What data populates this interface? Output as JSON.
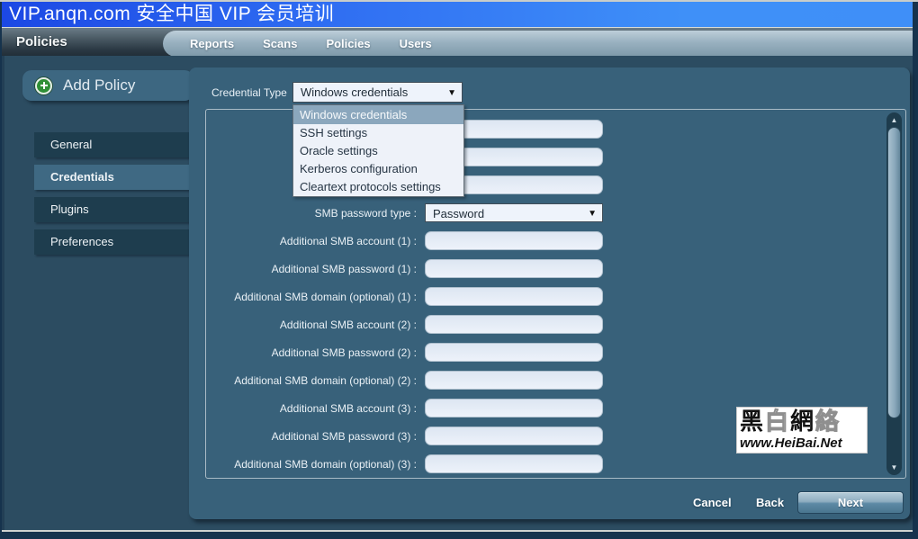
{
  "title_bar": {
    "text": "VIP.anqn.com 安全中国 VIP 会员培训"
  },
  "nav": {
    "section_title": "Policies",
    "tabs": [
      {
        "label": "Reports"
      },
      {
        "label": "Scans"
      },
      {
        "label": "Policies"
      },
      {
        "label": "Users"
      }
    ]
  },
  "sidebar": {
    "header": {
      "label": "Add Policy",
      "icon": "plus-icon"
    },
    "items": [
      {
        "label": "General",
        "selected": false
      },
      {
        "label": "Credentials",
        "selected": true
      },
      {
        "label": "Plugins",
        "selected": false
      },
      {
        "label": "Preferences",
        "selected": false
      }
    ]
  },
  "main": {
    "credential_type": {
      "label": "Credential Type",
      "value": "Windows credentials"
    },
    "dropdown": {
      "options": [
        {
          "label": "Windows credentials",
          "highlighted": true
        },
        {
          "label": "SSH settings",
          "highlighted": false
        },
        {
          "label": "Oracle settings",
          "highlighted": false
        },
        {
          "label": "Kerberos configuration",
          "highlighted": false
        },
        {
          "label": "Cleartext protocols settings",
          "highlighted": false
        }
      ]
    },
    "form": {
      "rows": [
        {
          "label": "",
          "control": "input",
          "value": ""
        },
        {
          "label": "",
          "control": "input",
          "value": ""
        },
        {
          "label": "",
          "control": "input",
          "value": ""
        },
        {
          "label": "SMB password type :",
          "control": "select",
          "value": "Password"
        },
        {
          "label": "Additional SMB account (1) :",
          "control": "input",
          "value": ""
        },
        {
          "label": "Additional SMB password (1) :",
          "control": "input",
          "value": ""
        },
        {
          "label": "Additional SMB domain (optional) (1) :",
          "control": "input",
          "value": ""
        },
        {
          "label": "Additional SMB account (2) :",
          "control": "input",
          "value": ""
        },
        {
          "label": "Additional SMB password (2) :",
          "control": "input",
          "value": ""
        },
        {
          "label": "Additional SMB domain (optional) (2) :",
          "control": "input",
          "value": ""
        },
        {
          "label": "Additional SMB account (3) :",
          "control": "input",
          "value": ""
        },
        {
          "label": "Additional SMB password (3) :",
          "control": "input",
          "value": ""
        },
        {
          "label": "Additional SMB domain (optional) (3) :",
          "control": "input",
          "value": ""
        }
      ]
    },
    "buttons": {
      "cancel": "Cancel",
      "back": "Back",
      "next": "Next"
    }
  },
  "watermark": {
    "line1": "黑白網絡",
    "line2": "www.HeiBai.Net"
  },
  "colors": {
    "title_blue_left": "#1c48e4",
    "title_blue_right": "#3f90f8",
    "page_background": "#2c4c61",
    "panel_background": "#38617a",
    "sidebar_item": "#1e3d4e",
    "sidebar_selected": "#3f6983",
    "dropdown_highlight": "#8ba7bd",
    "input_background": "#e9effa",
    "next_button_top": "#b6cdda",
    "next_button_bottom": "#49758f"
  }
}
